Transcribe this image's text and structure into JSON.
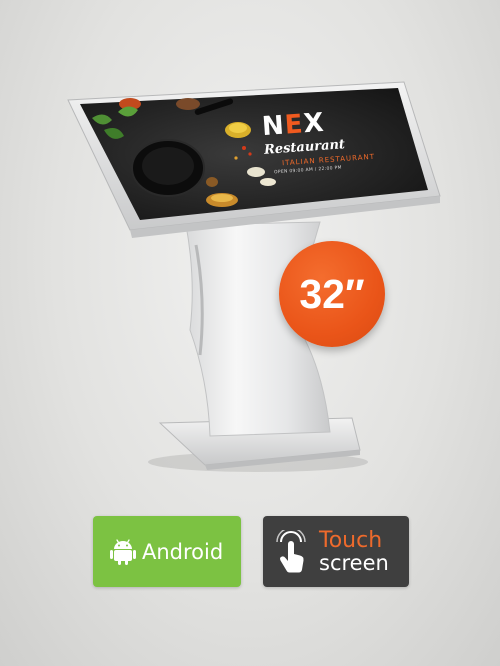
{
  "screen": {
    "brand_prefix": "N",
    "brand_accent": "E",
    "brand_suffix": "X",
    "brand_name": "Restaurant",
    "cuisine": "ITALIAN RESTAURANT",
    "hours": "OPEN 09:00 AM / 22:00 PM"
  },
  "badge": {
    "size_label": "32″",
    "color": "#ea5519"
  },
  "features": {
    "android": {
      "label": "Android",
      "icon": "android-icon",
      "color": "#7cc242"
    },
    "touch": {
      "line1": "Touch",
      "line2": "screen",
      "icon": "hand-touch-icon",
      "color": "#3f3f3f",
      "accent": "#ee6a2c"
    }
  }
}
